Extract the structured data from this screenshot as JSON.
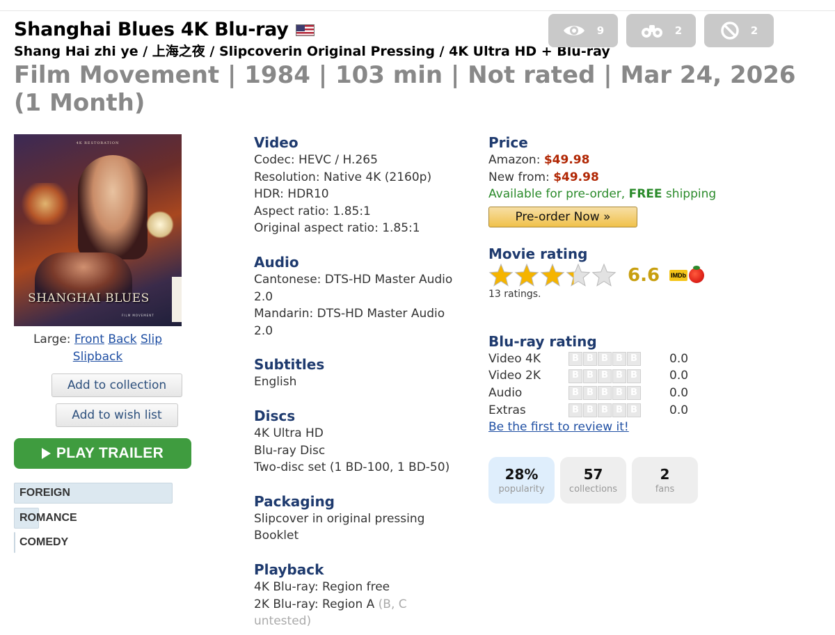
{
  "header": {
    "title": "Shanghai Blues 4K Blu-ray",
    "subtitle": "Shang Hai zhi ye / 上海之夜 / Slipcoverin Original Pressing / 4K Ultra HD + Blu-ray",
    "meta": "Film Movement | 1984 | 103 min | Not rated | Mar 24, 2026 (1 Month)",
    "stats": [
      {
        "icon": "eye-icon",
        "count": "9"
      },
      {
        "icon": "binoculars-icon",
        "count": "2"
      },
      {
        "icon": "ban-icon",
        "count": "2"
      }
    ]
  },
  "cover": {
    "restoration_text": "4K RESTORATION",
    "title_text": "SHANGHAI BLUES",
    "distributor_text": "FILM MOVEMENT"
  },
  "large": {
    "label": "Large:",
    "links": [
      "Front",
      "Back",
      "Slip",
      "Slipback"
    ]
  },
  "buttons": {
    "add_collection": "Add to collection",
    "add_wishlist": "Add to wish list",
    "play_trailer": "PLAY TRAILER"
  },
  "genres": [
    "FOREIGN",
    "ROMANCE",
    "COMEDY"
  ],
  "genre_levels": [
    1.0,
    0.16,
    0.01
  ],
  "video": {
    "title": "Video",
    "lines": [
      "Codec: HEVC / H.265",
      "Resolution: Native 4K (2160p)",
      "HDR: HDR10",
      "Aspect ratio: 1.85:1",
      "Original aspect ratio: 1.85:1"
    ]
  },
  "audio": {
    "title": "Audio",
    "lines": [
      "Cantonese: DTS-HD Master Audio",
      "2.0",
      "Mandarin: DTS-HD Master Audio",
      "2.0"
    ]
  },
  "subtitles": {
    "title": "Subtitles",
    "lines": [
      "English"
    ]
  },
  "discs": {
    "title": "Discs",
    "lines": [
      "4K Ultra HD",
      "Blu-ray Disc",
      "Two-disc set (1 BD-100, 1 BD-50)"
    ]
  },
  "packaging": {
    "title": "Packaging",
    "lines": [
      "Slipcover in original pressing",
      "Booklet"
    ]
  },
  "playback": {
    "title": "Playback",
    "line1": "4K Blu-ray: Region free",
    "line2_main": "2K Blu-ray: Region A",
    "line2_muted": " (B, C",
    "line3_muted": "untested)"
  },
  "price": {
    "title": "Price",
    "amazon_label": "Amazon: ",
    "amazon_value": "$49.98",
    "new_label": "New from: ",
    "new_value": "$49.98",
    "avail_pre": "Available for pre-order, ",
    "avail_bold": "FREE",
    "avail_post": " shipping",
    "preorder_label": "Pre-order Now »"
  },
  "movie_rating": {
    "title": "Movie rating",
    "stars": 3.3,
    "score": "6.6",
    "imdb_label": "IMDb",
    "ratings_count": "13 ratings."
  },
  "bluray_rating": {
    "title": "Blu-ray rating",
    "block_letter": "B",
    "rows": [
      {
        "label": "Video 4K",
        "value": "0.0"
      },
      {
        "label": "Video 2K",
        "value": "0.0"
      },
      {
        "label": "Audio",
        "value": "0.0"
      },
      {
        "label": "Extras",
        "value": "0.0"
      }
    ],
    "review_link": "Be the first to review it!"
  },
  "tiles": [
    {
      "value": "28%",
      "label": "popularity"
    },
    {
      "value": "57",
      "label": "collections"
    },
    {
      "value": "2",
      "label": "fans"
    }
  ],
  "colors": {
    "accent_blue": "#1e3a6e",
    "link": "#1f4fa3",
    "price_red": "#b12704",
    "available_green": "#2a8a2a",
    "trailer_green": "#3f9c3f",
    "star_gold": "#f5b400"
  }
}
